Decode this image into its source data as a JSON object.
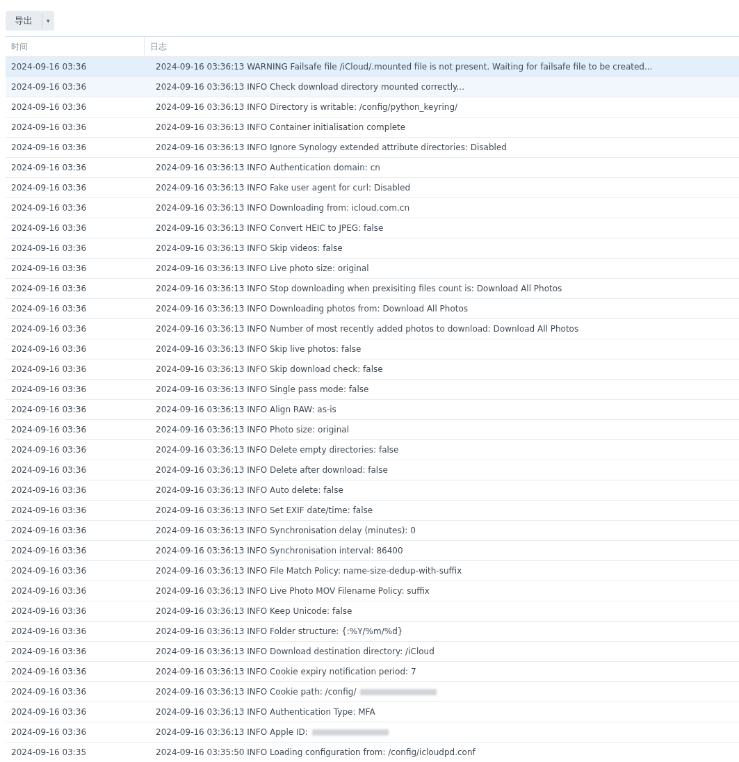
{
  "toolbar": {
    "export_button": "导出",
    "dropdown_caret": "▾"
  },
  "table": {
    "columns": [
      "时间",
      "日志"
    ],
    "rows": [
      {
        "time": "2024-09-16 03:36",
        "log": "2024-09-16 03:36:13 WARNING Failsafe file /iCloud/.mounted file is not present. Waiting for failsafe file to be created...",
        "selected": true,
        "hovered": false,
        "redacted": false
      },
      {
        "time": "2024-09-16 03:36",
        "log": "2024-09-16 03:36:13 INFO Check download directory mounted correctly...",
        "selected": false,
        "hovered": true,
        "redacted": false
      },
      {
        "time": "2024-09-16 03:36",
        "log": "2024-09-16 03:36:13 INFO Directory is writable: /config/python_keyring/",
        "selected": false,
        "hovered": false,
        "redacted": false
      },
      {
        "time": "2024-09-16 03:36",
        "log": "2024-09-16 03:36:13 INFO Container initialisation complete",
        "selected": false,
        "hovered": false,
        "redacted": false
      },
      {
        "time": "2024-09-16 03:36",
        "log": "2024-09-16 03:36:13 INFO Ignore Synology extended attribute directories: Disabled",
        "selected": false,
        "hovered": false,
        "redacted": false
      },
      {
        "time": "2024-09-16 03:36",
        "log": "2024-09-16 03:36:13 INFO Authentication domain: cn",
        "selected": false,
        "hovered": false,
        "redacted": false
      },
      {
        "time": "2024-09-16 03:36",
        "log": "2024-09-16 03:36:13 INFO Fake user agent for curl: Disabled",
        "selected": false,
        "hovered": false,
        "redacted": false
      },
      {
        "time": "2024-09-16 03:36",
        "log": "2024-09-16 03:36:13 INFO Downloading from: icloud.com.cn",
        "selected": false,
        "hovered": false,
        "redacted": false
      },
      {
        "time": "2024-09-16 03:36",
        "log": "2024-09-16 03:36:13 INFO Convert HEIC to JPEG: false",
        "selected": false,
        "hovered": false,
        "redacted": false
      },
      {
        "time": "2024-09-16 03:36",
        "log": "2024-09-16 03:36:13 INFO Skip videos: false",
        "selected": false,
        "hovered": false,
        "redacted": false
      },
      {
        "time": "2024-09-16 03:36",
        "log": "2024-09-16 03:36:13 INFO Live photo size: original",
        "selected": false,
        "hovered": false,
        "redacted": false
      },
      {
        "time": "2024-09-16 03:36",
        "log": "2024-09-16 03:36:13 INFO Stop downloading when prexisiting files count is: Download All Photos",
        "selected": false,
        "hovered": false,
        "redacted": false
      },
      {
        "time": "2024-09-16 03:36",
        "log": "2024-09-16 03:36:13 INFO Downloading photos from: Download All Photos",
        "selected": false,
        "hovered": false,
        "redacted": false
      },
      {
        "time": "2024-09-16 03:36",
        "log": "2024-09-16 03:36:13 INFO Number of most recently added photos to download: Download All Photos",
        "selected": false,
        "hovered": false,
        "redacted": false
      },
      {
        "time": "2024-09-16 03:36",
        "log": "2024-09-16 03:36:13 INFO Skip live photos: false",
        "selected": false,
        "hovered": false,
        "redacted": false
      },
      {
        "time": "2024-09-16 03:36",
        "log": "2024-09-16 03:36:13 INFO Skip download check: false",
        "selected": false,
        "hovered": false,
        "redacted": false
      },
      {
        "time": "2024-09-16 03:36",
        "log": "2024-09-16 03:36:13 INFO Single pass mode: false",
        "selected": false,
        "hovered": false,
        "redacted": false
      },
      {
        "time": "2024-09-16 03:36",
        "log": "2024-09-16 03:36:13 INFO Align RAW: as-is",
        "selected": false,
        "hovered": false,
        "redacted": false
      },
      {
        "time": "2024-09-16 03:36",
        "log": "2024-09-16 03:36:13 INFO Photo size: original",
        "selected": false,
        "hovered": false,
        "redacted": false
      },
      {
        "time": "2024-09-16 03:36",
        "log": "2024-09-16 03:36:13 INFO Delete empty directories: false",
        "selected": false,
        "hovered": false,
        "redacted": false
      },
      {
        "time": "2024-09-16 03:36",
        "log": "2024-09-16 03:36:13 INFO Delete after download: false",
        "selected": false,
        "hovered": false,
        "redacted": false
      },
      {
        "time": "2024-09-16 03:36",
        "log": "2024-09-16 03:36:13 INFO Auto delete: false",
        "selected": false,
        "hovered": false,
        "redacted": false
      },
      {
        "time": "2024-09-16 03:36",
        "log": "2024-09-16 03:36:13 INFO Set EXIF date/time: false",
        "selected": false,
        "hovered": false,
        "redacted": false
      },
      {
        "time": "2024-09-16 03:36",
        "log": "2024-09-16 03:36:13 INFO Synchronisation delay (minutes): 0",
        "selected": false,
        "hovered": false,
        "redacted": false
      },
      {
        "time": "2024-09-16 03:36",
        "log": "2024-09-16 03:36:13 INFO Synchronisation interval: 86400",
        "selected": false,
        "hovered": false,
        "redacted": false
      },
      {
        "time": "2024-09-16 03:36",
        "log": "2024-09-16 03:36:13 INFO File Match Policy: name-size-dedup-with-suffix",
        "selected": false,
        "hovered": false,
        "redacted": false
      },
      {
        "time": "2024-09-16 03:36",
        "log": "2024-09-16 03:36:13 INFO Live Photo MOV Filename Policy: suffix",
        "selected": false,
        "hovered": false,
        "redacted": false
      },
      {
        "time": "2024-09-16 03:36",
        "log": "2024-09-16 03:36:13 INFO Keep Unicode: false",
        "selected": false,
        "hovered": false,
        "redacted": false
      },
      {
        "time": "2024-09-16 03:36",
        "log": "2024-09-16 03:36:13 INFO Folder structure: {:%Y/%m/%d}",
        "selected": false,
        "hovered": false,
        "redacted": false
      },
      {
        "time": "2024-09-16 03:36",
        "log": "2024-09-16 03:36:13 INFO Download destination directory: /iCloud",
        "selected": false,
        "hovered": false,
        "redacted": false
      },
      {
        "time": "2024-09-16 03:36",
        "log": "2024-09-16 03:36:13 INFO Cookie expiry notification period: 7",
        "selected": false,
        "hovered": false,
        "redacted": false
      },
      {
        "time": "2024-09-16 03:36",
        "log": "2024-09-16 03:36:13 INFO Cookie path: /config/",
        "selected": false,
        "hovered": false,
        "redacted": true
      },
      {
        "time": "2024-09-16 03:36",
        "log": "2024-09-16 03:36:13 INFO Authentication Type: MFA",
        "selected": false,
        "hovered": false,
        "redacted": false
      },
      {
        "time": "2024-09-16 03:36",
        "log": "2024-09-16 03:36:13 INFO Apple ID:",
        "selected": false,
        "hovered": false,
        "redacted": true
      },
      {
        "time": "2024-09-16 03:35",
        "log": "2024-09-16 03:35:50 INFO Loading configuration from: /config/icloudpd.conf",
        "selected": false,
        "hovered": false,
        "redacted": false
      }
    ]
  }
}
